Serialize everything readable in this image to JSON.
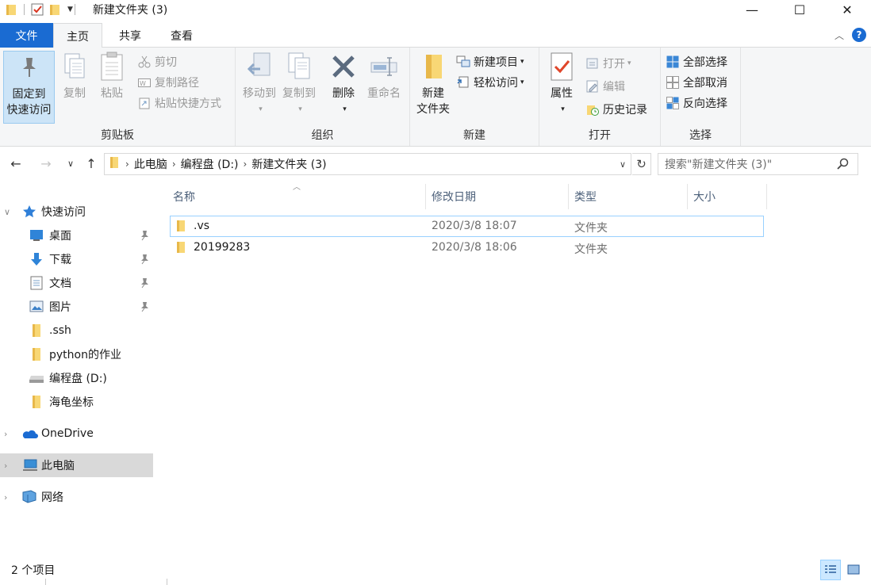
{
  "window": {
    "title": "新建文件夹 (3)",
    "controls": {
      "minimize": "—",
      "maximize": "☐",
      "close": "✕"
    }
  },
  "ribbon_tabs": {
    "file": "文件",
    "home": "主页",
    "share": "共享",
    "view": "查看",
    "help": "?"
  },
  "ribbon": {
    "clipboard": {
      "label": "剪贴板",
      "pin_line1": "固定到",
      "pin_line2": "快速访问",
      "copy": "复制",
      "paste": "粘贴",
      "cut": "剪切",
      "copy_path": "复制路径",
      "paste_shortcut": "粘贴快捷方式"
    },
    "organize": {
      "label": "组织",
      "move_to": "移动到",
      "copy_to": "复制到",
      "delete": "删除",
      "rename": "重命名"
    },
    "new": {
      "label": "新建",
      "new_folder_line1": "新建",
      "new_folder_line2": "文件夹",
      "new_item": "新建项目",
      "easy_access": "轻松访问"
    },
    "open": {
      "label": "打开",
      "properties": "属性",
      "open": "打开",
      "edit": "编辑",
      "history": "历史记录"
    },
    "select": {
      "label": "选择",
      "select_all": "全部选择",
      "select_none": "全部取消",
      "invert": "反向选择"
    }
  },
  "address": {
    "crumbs": [
      "此电脑",
      "编程盘 (D:)",
      "新建文件夹 (3)"
    ],
    "search_placeholder": "搜索\"新建文件夹 (3)\""
  },
  "nav": {
    "quick_access": "快速访问",
    "items": [
      {
        "label": "桌面",
        "icon": "desktop-icon",
        "pinned": true
      },
      {
        "label": "下载",
        "icon": "download-icon",
        "pinned": true
      },
      {
        "label": "文档",
        "icon": "document-icon",
        "pinned": true
      },
      {
        "label": "图片",
        "icon": "picture-icon",
        "pinned": true
      },
      {
        "label": ".ssh",
        "icon": "folder-icon",
        "pinned": false
      },
      {
        "label": "python的作业",
        "icon": "folder-icon",
        "pinned": false
      },
      {
        "label": "编程盘 (D:)",
        "icon": "drive-icon",
        "pinned": false
      },
      {
        "label": "海龟坐标",
        "icon": "folder-icon",
        "pinned": false
      }
    ],
    "onedrive": "OneDrive",
    "this_pc": "此电脑",
    "network": "网络"
  },
  "columns": {
    "name": "名称",
    "modified": "修改日期",
    "type": "类型",
    "size": "大小"
  },
  "files": [
    {
      "name": ".vs",
      "modified": "2020/3/8 18:07",
      "type": "文件夹",
      "size": ""
    },
    {
      "name": "20199283",
      "modified": "2020/3/8 18:06",
      "type": "文件夹",
      "size": ""
    }
  ],
  "status": {
    "item_count": "2 个项目"
  },
  "colors": {
    "accent": "#1a6bd2",
    "folder": "#f8d775",
    "folder_dark": "#e8b84a",
    "selection": "#cce8ff"
  }
}
